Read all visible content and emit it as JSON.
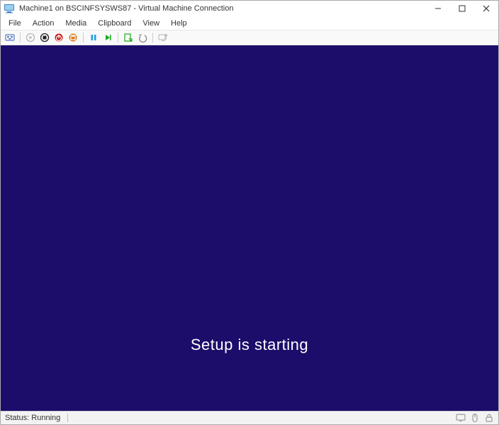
{
  "title": "Machine1 on BSCINFSYSWS87 - Virtual Machine Connection",
  "menu": {
    "file": "File",
    "action": "Action",
    "media": "Media",
    "clipboard": "Clipboard",
    "view": "View",
    "help": "Help"
  },
  "viewport": {
    "message": "Setup is starting"
  },
  "status": {
    "text": "Status: Running"
  }
}
